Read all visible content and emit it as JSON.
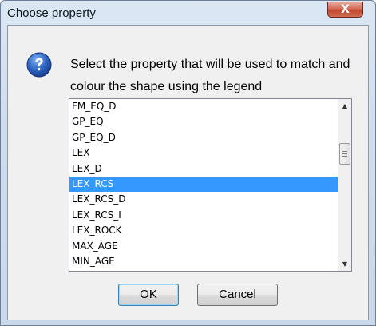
{
  "window": {
    "title": "Choose property",
    "close_glyph": "X"
  },
  "message": {
    "icon": "question-icon",
    "text": "Select the property that will be used to match and colour the shape using the legend"
  },
  "list": {
    "items": [
      "FM_EQ_D",
      "GP_EQ",
      "GP_EQ_D",
      "LEX",
      "LEX_D",
      "LEX_RCS",
      "LEX_RCS_D",
      "LEX_RCS_I",
      "LEX_ROCK",
      "MAX_AGE",
      "MIN_AGE"
    ],
    "selected_index": 5
  },
  "buttons": {
    "ok": "OK",
    "cancel": "Cancel"
  },
  "colors": {
    "selection": "#3399ff",
    "close_button": "#c2472f"
  }
}
